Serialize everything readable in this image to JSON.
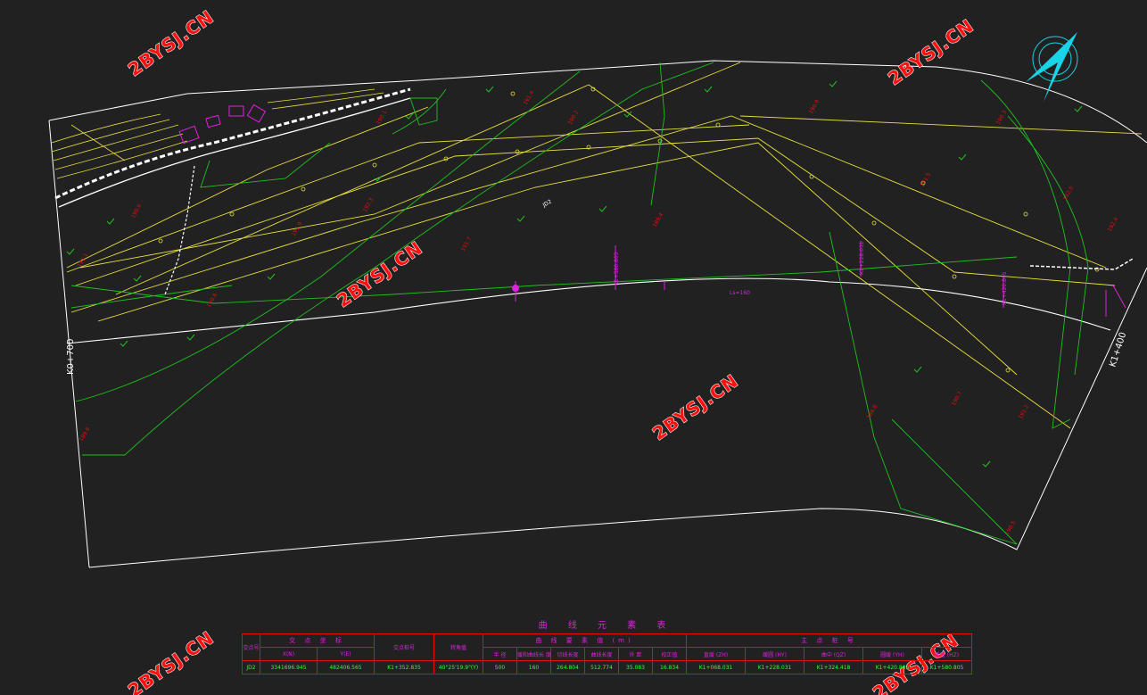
{
  "watermark": "2BYSJ.CN",
  "stations": {
    "start": "K0+700",
    "end": "K1+400"
  },
  "labels": {
    "jd": "JD2",
    "ls": "Ls=160",
    "compass_symbol": "N"
  },
  "colors": {
    "background": "#212121",
    "boundary": "#ffffff",
    "survey_line": "#e8e040",
    "contour": "#20c020",
    "elevation_text": "#e01010",
    "annotation": "#e020e0",
    "compass": "#19d3e6"
  },
  "elevation_marks": [
    "190.6",
    "191.1",
    "190.8",
    "192.3",
    "191.7",
    "190.2",
    "189.4",
    "190.9",
    "191.5",
    "192.0",
    "190.3",
    "189.8",
    "191.2",
    "190.7",
    "192.4",
    "191.9",
    "190.1",
    "189.6",
    "191.4",
    "190.5"
  ],
  "curve_table": {
    "title": "曲 线 元 素 表",
    "header": {
      "jd_no": "交点号",
      "coord": "交 点 坐 标",
      "station": "交点桩号",
      "deflection": "转角值",
      "elements": "曲 线 要 素 值 (m)",
      "points": "主 点 桩 号"
    },
    "subheader": {
      "x": "X(N)",
      "y": "Y(E)",
      "radius": "半 径",
      "ls": "缓和曲线长 度",
      "tangent": "切线长度",
      "curve_len": "曲线长度",
      "external": "外 距",
      "correction": "校正值",
      "zh": "直缓 (ZH)",
      "hy": "缓圆 (HY)",
      "qz": "曲中 (QZ)",
      "yh": "圆缓 (YH)",
      "hz": "缓直 (HZ)"
    },
    "row": {
      "jd": "JD2",
      "x": "3341696.945",
      "y": "482406.565",
      "station": "K1+352.835",
      "deflection": "40°25'19.9\"(Y)",
      "radius": "500",
      "ls": "160",
      "tangent": "264.804",
      "curve_len": "512.774",
      "external": "35.083",
      "correction": "16.834",
      "zh": "K1+068.031",
      "hy": "K1+228.031",
      "qz": "K1+324.418",
      "yh": "K1+420.805",
      "hz": "K1+580.805"
    }
  }
}
